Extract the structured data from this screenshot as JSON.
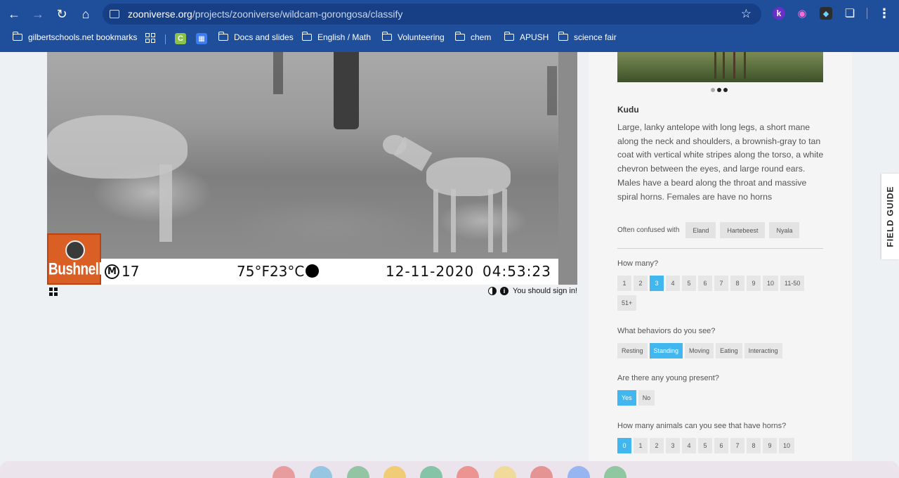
{
  "browser": {
    "url_host": "zooniverse.org",
    "url_path": "/projects/zooniverse/wildcam-gorongosa/classify",
    "extensions": [
      "k"
    ],
    "bookmarks": [
      {
        "label": "gilbertschools.net bookmarks",
        "icon": "folder-icon"
      },
      {
        "label": "Docs and slides",
        "icon": "folder-icon"
      },
      {
        "label": "English / Math",
        "icon": "folder-icon"
      },
      {
        "label": "Volunteering",
        "icon": "folder-icon"
      },
      {
        "label": "chem",
        "icon": "folder-icon"
      },
      {
        "label": "APUSH",
        "icon": "folder-icon"
      },
      {
        "label": "science fair",
        "icon": "folder-icon"
      }
    ],
    "bookmark_app_c": "C"
  },
  "camera": {
    "brand": "Bushnell",
    "moon_letter": "M",
    "camera_number": "17",
    "temperature": "75°F23°C",
    "date": "12-11-2020",
    "time": "04:53:23"
  },
  "below_camera": {
    "signin_text": "You should sign in!"
  },
  "field_guide": {
    "tab_label": "FIELD GUIDE",
    "species_name": "Kudu",
    "description": "Large, lanky antelope with long legs, a short mane along the neck and shoulders, a brownish-gray to tan coat with vertical white stripes along the torso, a white chevron between the eyes, and large round ears. Males have a beard along the throat and massive spiral horns. Females are have no horns",
    "confused_label": "Often confused with",
    "confused_with": [
      "Eland",
      "Hartebeest",
      "Nyala"
    ]
  },
  "questions": {
    "how_many": {
      "label": "How many?",
      "options": [
        "1",
        "2",
        "3",
        "4",
        "5",
        "6",
        "7",
        "8",
        "9",
        "10",
        "11-50",
        "51+"
      ],
      "selected": "3"
    },
    "behaviors": {
      "label": "What behaviors do you see?",
      "options": [
        "Resting",
        "Standing",
        "Moving",
        "Eating",
        "Interacting"
      ],
      "selected": "Standing"
    },
    "young": {
      "label": "Are there any young present?",
      "options": [
        "Yes",
        "No"
      ],
      "selected": "Yes"
    },
    "horns": {
      "label": "How many animals can you see that have horns?",
      "options": [
        "0",
        "1",
        "2",
        "3",
        "4",
        "5",
        "6",
        "7",
        "8",
        "9",
        "10"
      ],
      "selected": "0"
    }
  },
  "colors": {
    "chrome": "#1f4e9a",
    "accent": "#41b6ef",
    "bushnell": "#d95f25"
  }
}
